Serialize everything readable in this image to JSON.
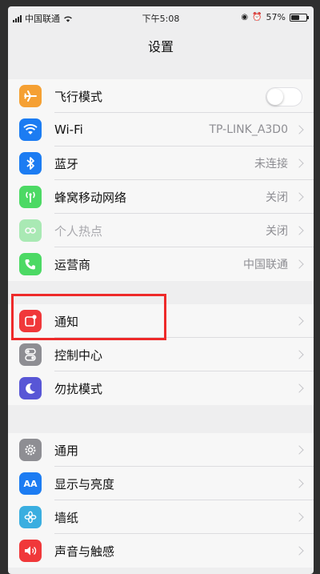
{
  "status_bar": {
    "carrier": "中国联通",
    "time": "下午5:08",
    "battery": "57%",
    "battery_level": 0.57
  },
  "nav": {
    "title": "设置"
  },
  "colors": {
    "highlight": "#ee2a2a",
    "airplane": "#f5a033",
    "wifi": "#1c7cf2",
    "bluetooth": "#1c7cf2",
    "cellular": "#4cd964",
    "hotspot": "#4cd964",
    "carrier": "#4cd964",
    "notifications": "#f0383a",
    "control": "#8e8e93",
    "dnd": "#5856d6",
    "general": "#8e8e93",
    "display": "#1c7cf2",
    "wallpaper": "#3aaee0",
    "sounds": "#f0383a"
  },
  "group1": [
    {
      "label": "飞行模式",
      "icon": "airplane-icon",
      "toggle": false
    },
    {
      "label": "Wi-Fi",
      "icon": "wifi-icon",
      "value": "TP-LINK_A3D0"
    },
    {
      "label": "蓝牙",
      "icon": "bluetooth-icon",
      "value": "未连接"
    },
    {
      "label": "蜂窝移动网络",
      "icon": "cellular-icon",
      "value": "关闭"
    },
    {
      "label": "个人热点",
      "icon": "hotspot-icon",
      "value": "关闭"
    },
    {
      "label": "运营商",
      "icon": "phone-icon",
      "value": "中国联通"
    }
  ],
  "group2": [
    {
      "label": "通知",
      "icon": "notifications-icon"
    },
    {
      "label": "控制中心",
      "icon": "control-center-icon"
    },
    {
      "label": "勿扰模式",
      "icon": "moon-icon"
    }
  ],
  "group3": [
    {
      "label": "通用",
      "icon": "gear-icon"
    },
    {
      "label": "显示与亮度",
      "icon": "display-icon",
      "icon_text": "AA"
    },
    {
      "label": "墙纸",
      "icon": "wallpaper-icon"
    },
    {
      "label": "声音与触感",
      "icon": "speaker-icon"
    }
  ]
}
